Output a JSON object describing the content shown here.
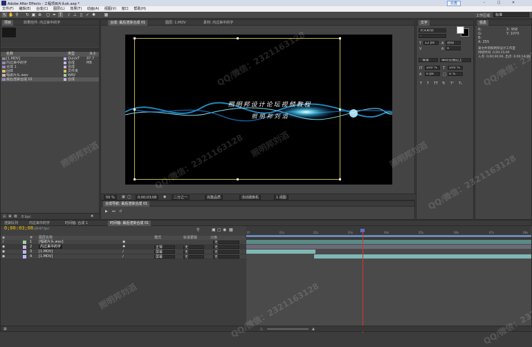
{
  "app": {
    "title": "Adobe After Effects - 工程项目片头ok.aep *",
    "cloud_label": "云盘"
  },
  "menu": [
    "文件(F)",
    "编辑(E)",
    "合成(C)",
    "图层(L)",
    "效果(T)",
    "动画(A)",
    "视图(V)",
    "窗口",
    "帮助(H)"
  ],
  "workspace": {
    "label": "工作区域:",
    "value": "标准"
  },
  "project": {
    "tabs": [
      "项目",
      "效果控件: 内过来中的字"
    ],
    "columns": {
      "name": "名称",
      "type": "类型",
      "size": "大小"
    },
    "items": [
      {
        "name": "[1.MOV]",
        "type": "QuickT",
        "size": "97.7 MB",
        "color": "#b8b8ff"
      },
      {
        "name": "内过来中的字",
        "type": "合成",
        "size": "",
        "color": "#c8b4e0"
      },
      {
        "name": "合成 1",
        "type": "合成",
        "size": "",
        "color": "#c8b4e0"
      },
      {
        "name": "固体",
        "type": "文件夹",
        "size": "",
        "color": "#d8c25a"
      },
      {
        "name": "唱歌片头.wav",
        "type": "WAV",
        "size": "",
        "color": "#9fd0a0"
      },
      {
        "name": "最后渲染合成 01",
        "type": "合成",
        "size": "",
        "color": "#c8b4e0"
      }
    ],
    "bpc": "8 bpc"
  },
  "composition": {
    "tabs": [
      "合成: 最后渲染合成 01",
      "图层: 1.MOV",
      "素材: 内过来中的字"
    ],
    "text_line1": "照明邦设计论坛视频教程",
    "text_line2": "照明邦刘滔",
    "zoom": "50 %",
    "timecode": "0;00;03;08",
    "resolution": "二分之一",
    "quality": "完整品质",
    "camera": "活动摄像机",
    "views": "1 视图",
    "mini_tab": "合成导航: 最后渲染合成 01"
  },
  "character": {
    "tab": "文字",
    "font": "华文彩云",
    "style": "-",
    "size": "12 px",
    "leading": "自动",
    "tracking": "0",
    "stroke_width": "- 像素",
    "stroke_mode": "填充在描边上",
    "scale_v": "100 %",
    "scale_h": "100 %",
    "baseline": "0 px",
    "tsume": "0 %",
    "style_buttons": [
      "T",
      "T",
      "TT",
      "Tr",
      "T¹",
      "T₁"
    ]
  },
  "info": {
    "tab": "信息",
    "r": "R:",
    "g": "G:",
    "b": "B:",
    "a": "A: 255",
    "x": "X: 958",
    "y": "Y: 1070",
    "msg1": "来文件到照明邦设计工作室",
    "msg2": "持续时间: 0;00;15;00",
    "msg3": "入点: 0;00;00;00, 出点: 0;00;14;29"
  },
  "timeline": {
    "tabs": [
      "渲染队列",
      "内过来中的字",
      "时间轴: 合成 1",
      "时间轴: 最后渲染合成 01"
    ],
    "timecode": "0;00:03;08",
    "fps": "(29.97 fps)",
    "columns": {
      "num": "#",
      "name": "图层名称",
      "mode": "模式",
      "trkmat": "轨道蒙版",
      "parent": "父级"
    },
    "layers": [
      {
        "num": "1",
        "name": "[唱歌片头.wav]",
        "mode": "",
        "trkmat": "",
        "parent": "无"
      },
      {
        "num": "2",
        "name": "内过来中的字",
        "mode": "正常",
        "trkmat": "无",
        "parent": "无"
      },
      {
        "num": "3",
        "name": "[1.MOV]",
        "mode": "屏幕",
        "trkmat": "无",
        "parent": "无"
      },
      {
        "num": "4",
        "name": "[1.MOV]",
        "mode": "屏幕",
        "trkmat": "无",
        "parent": "无"
      }
    ],
    "ticks": [
      "0f",
      "01s",
      "02s",
      "03s",
      "04s",
      "05s",
      "06s",
      "07s",
      "08s"
    ]
  },
  "watermarks": [
    "照明邦刘滔",
    "QQ/微信：2321163128"
  ]
}
